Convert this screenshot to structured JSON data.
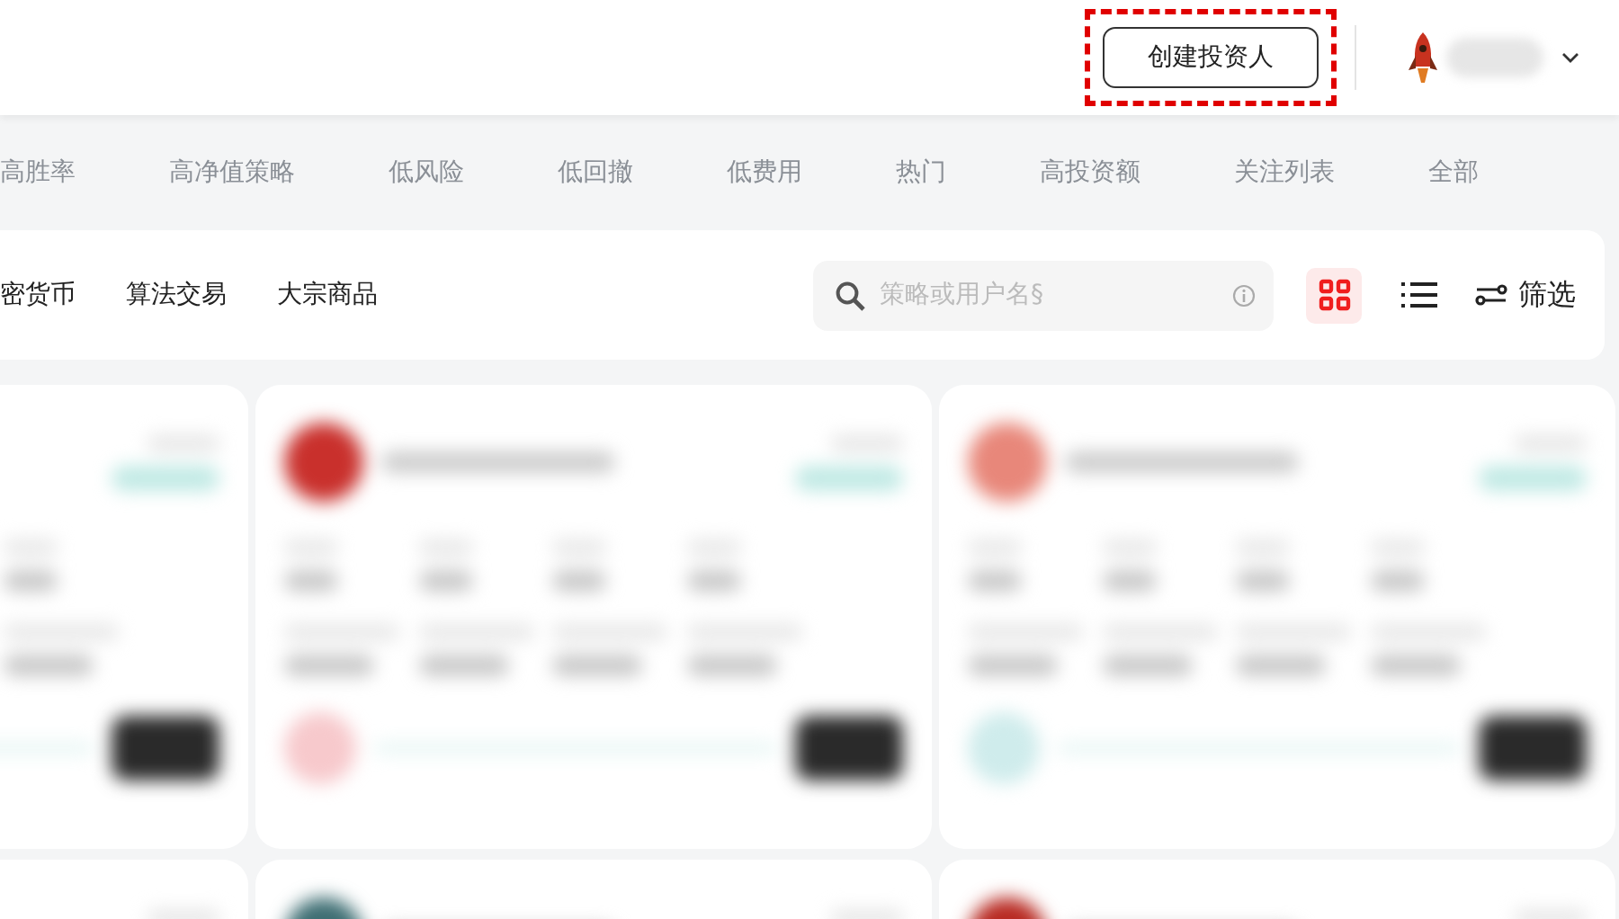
{
  "header": {
    "create_button": {
      "label": "创建投资人",
      "highlighted": true
    }
  },
  "categories": [
    {
      "label": "高胜率",
      "selected": false
    },
    {
      "label": "高净值策略",
      "selected": false
    },
    {
      "label": "低风险",
      "selected": false
    },
    {
      "label": "低回撤",
      "selected": false
    },
    {
      "label": "低费用",
      "selected": false
    },
    {
      "label": "热门",
      "selected": false
    },
    {
      "label": "高投资额",
      "selected": false
    },
    {
      "label": "关注列表",
      "selected": false
    },
    {
      "label": "全部",
      "selected": false
    }
  ],
  "subcategories": [
    {
      "label": "密货币",
      "selected": false
    },
    {
      "label": "算法交易",
      "selected": false
    },
    {
      "label": "大宗商品",
      "selected": false
    }
  ],
  "search": {
    "placeholder": "策略或用户名§"
  },
  "view_modes": [
    {
      "kind": "grid",
      "selected": true
    },
    {
      "kind": "list",
      "selected": false
    }
  ],
  "filter_button": {
    "label": "筛选"
  }
}
